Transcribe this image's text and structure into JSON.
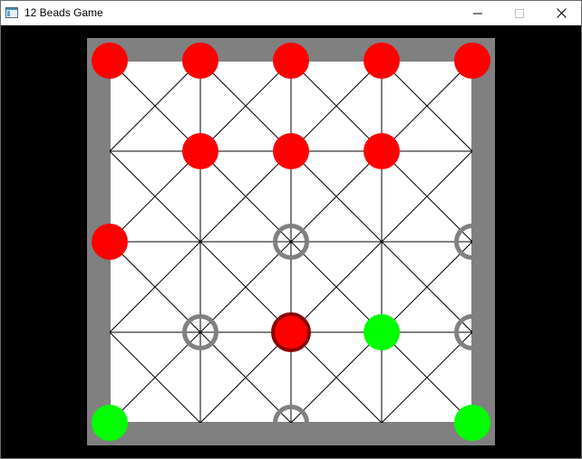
{
  "window": {
    "title": "12 Beads Game",
    "controls": {
      "minimize": "minimize-icon",
      "maximize": "maximize-icon",
      "close": "close-icon"
    }
  },
  "colors": {
    "frame": "#808080",
    "board": "#ffffff",
    "line": "#000000",
    "red": "#ff0000",
    "red_selected_ring": "#8b0000",
    "green": "#00ff00",
    "empty_ring": "#808080"
  },
  "board": {
    "grid": "5x5",
    "cells": [
      [
        "red",
        "red",
        "red",
        "red",
        "red"
      ],
      [
        "empty",
        "red",
        "red",
        "red",
        "empty"
      ],
      [
        "red",
        "empty",
        "empty-marked",
        "empty",
        "empty-marked"
      ],
      [
        "empty",
        "empty-marked",
        "red-selected",
        "green",
        "empty-marked"
      ],
      [
        "green",
        "empty",
        "empty-marked",
        "empty",
        "green"
      ]
    ]
  }
}
